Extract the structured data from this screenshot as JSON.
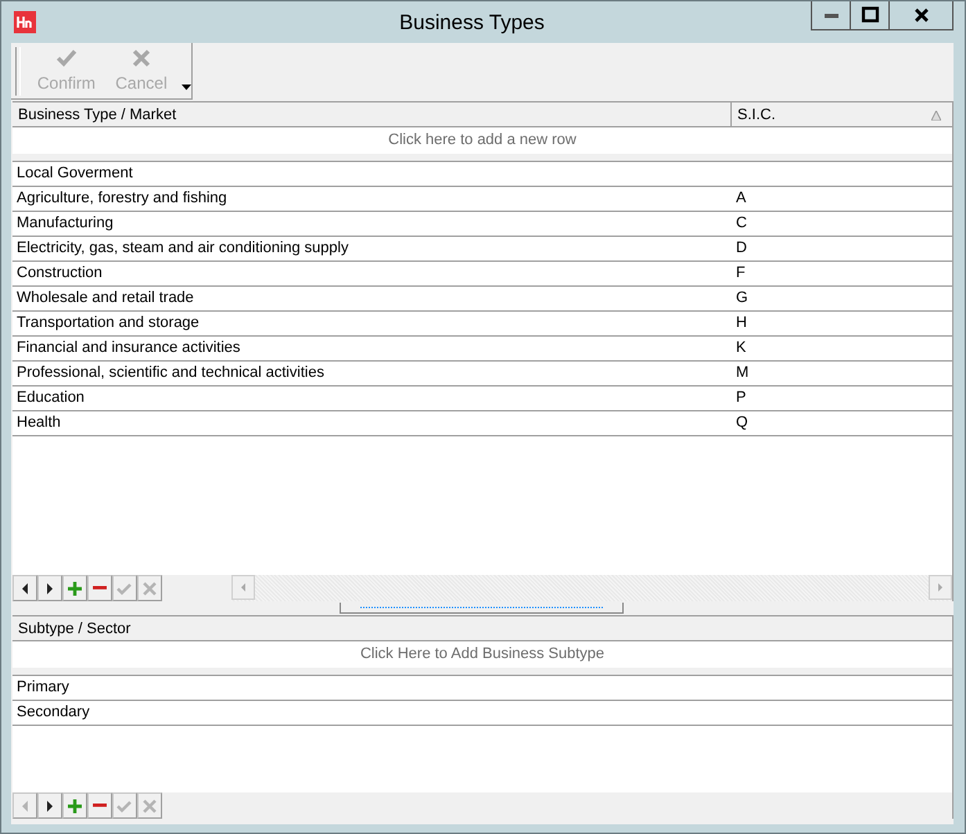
{
  "window": {
    "title": "Business Types"
  },
  "toolbar": {
    "buttons": [
      {
        "label": "Confirm",
        "kind": "confirm",
        "disabled": true
      },
      {
        "label": "Cancel",
        "kind": "cancel",
        "disabled": true
      }
    ]
  },
  "business_grid": {
    "columns": [
      "Business Type / Market",
      "S.I.C."
    ],
    "new_row_prompt": "Click here to add a new row",
    "rows": [
      {
        "cells": [
          "Local Goverment",
          ""
        ]
      },
      {
        "cells": [
          "Agriculture, forestry and fishing",
          "A"
        ]
      },
      {
        "cells": [
          "Manufacturing",
          "C"
        ]
      },
      {
        "cells": [
          "Electricity, gas, steam and air conditioning supply",
          "D"
        ]
      },
      {
        "cells": [
          "Construction",
          "F"
        ]
      },
      {
        "cells": [
          "Wholesale and retail trade",
          "G"
        ]
      },
      {
        "cells": [
          "Transportation and storage",
          "H"
        ]
      },
      {
        "cells": [
          "Financial and insurance activities",
          "K"
        ]
      },
      {
        "cells": [
          "Professional, scientific and technical activities",
          "M"
        ]
      },
      {
        "cells": [
          "Education",
          "P"
        ]
      },
      {
        "cells": [
          "Health",
          "Q"
        ]
      }
    ],
    "navigator": [
      {
        "kind": "prev",
        "disabled": false
      },
      {
        "kind": "next",
        "disabled": false
      },
      {
        "kind": "add",
        "disabled": false
      },
      {
        "kind": "delete",
        "disabled": false
      },
      {
        "kind": "post",
        "disabled": true
      },
      {
        "kind": "cancel",
        "disabled": true
      }
    ]
  },
  "subtype_grid": {
    "columns": [
      "Subtype / Sector"
    ],
    "new_row_prompt": "Click Here to Add Business Subtype",
    "rows": [
      {
        "cells": [
          "Primary"
        ]
      },
      {
        "cells": [
          "Secondary"
        ]
      }
    ],
    "navigator": [
      {
        "kind": "prev",
        "disabled": true
      },
      {
        "kind": "next",
        "disabled": false
      },
      {
        "kind": "add",
        "disabled": false
      },
      {
        "kind": "delete",
        "disabled": false
      },
      {
        "kind": "post",
        "disabled": true
      },
      {
        "kind": "cancel",
        "disabled": true
      }
    ]
  }
}
